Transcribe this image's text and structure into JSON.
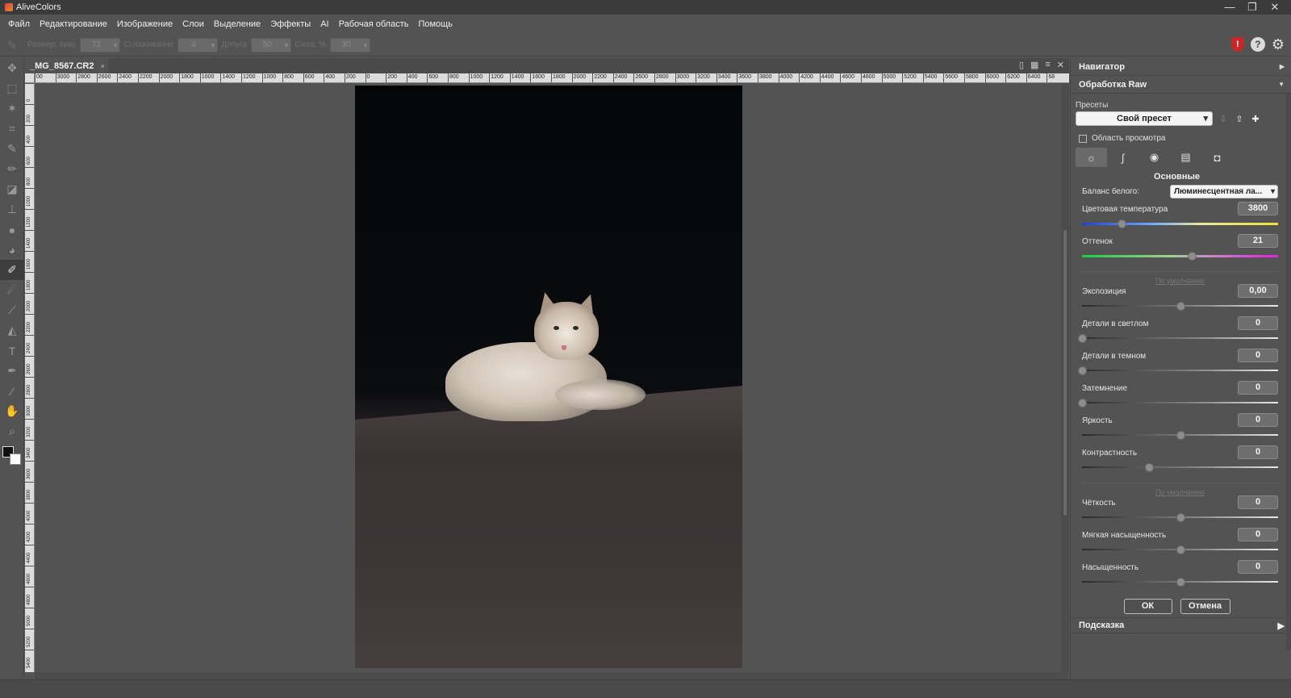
{
  "app": {
    "title": "AliveColors"
  },
  "window_controls": {
    "minimize": "—",
    "maximize": "❐",
    "close": "✕"
  },
  "menu": [
    "Файл",
    "Редактирование",
    "Изображение",
    "Слои",
    "Выделение",
    "Эффекты",
    "AI",
    "Рабочая область",
    "Помощь"
  ],
  "options_bar": {
    "size_label": "Размер, пикс",
    "size_value": "72",
    "smoothing_label": "Сглаживание",
    "smoothing_value": "4",
    "tolerance_label": "Допуск",
    "tolerance_value": "50",
    "strength_label": "Сила, %",
    "strength_value": "30"
  },
  "document": {
    "tab_title": "_MG_8567.CR2",
    "tab_close": "×"
  },
  "ruler": {
    "h_labels": [
      "00",
      "3000",
      "2800",
      "2600",
      "2400",
      "2200",
      "2000",
      "1800",
      "1600",
      "1400",
      "1200",
      "1000",
      "800",
      "600",
      "400",
      "200",
      "0",
      "200",
      "400",
      "600",
      "800",
      "1000",
      "1200",
      "1400",
      "1600",
      "1800",
      "2000",
      "2200",
      "2400",
      "2600",
      "2800",
      "3000",
      "3200",
      "3400",
      "3600",
      "3800",
      "4000",
      "4200",
      "4400",
      "4600",
      "4800",
      "5000",
      "5200",
      "5400",
      "5600",
      "5800",
      "6000",
      "6200",
      "6400",
      "68"
    ],
    "v_labels": [
      "0",
      "200",
      "400",
      "600",
      "800",
      "1000",
      "1200",
      "1400",
      "1600",
      "1800",
      "2000",
      "2200",
      "2400",
      "2600",
      "2800",
      "3000",
      "3200",
      "3400",
      "3600",
      "3800",
      "4000",
      "4200",
      "4400",
      "4600",
      "4800",
      "5000",
      "5200",
      "5400"
    ]
  },
  "panels": {
    "navigator": "Навигатор",
    "raw": "Обработка Raw",
    "hint": "Подсказка"
  },
  "raw": {
    "presets_label": "Пресеты",
    "preset_value": "Свой пресет",
    "preview_area_label": "Область просмотра",
    "section_title": "Основные",
    "wb_label": "Баланс белого:",
    "wb_value": "Люминесцентная ла...",
    "default_link": "По умолчанию",
    "ok": "ОК",
    "cancel": "Отмена",
    "sliders_group1": [
      {
        "label": "Цветовая температура",
        "value": "3800",
        "pos": 0.2,
        "style": "temp"
      },
      {
        "label": "Оттенок",
        "value": "21",
        "pos": 0.56,
        "style": "tint"
      }
    ],
    "sliders_group2": [
      {
        "label": "Экспозиция",
        "value": "0,00",
        "pos": 0.5
      },
      {
        "label": "Детали в светлом",
        "value": "0",
        "pos": 0.0
      },
      {
        "label": "Детали в темном",
        "value": "0",
        "pos": 0.0
      },
      {
        "label": "Затемнение",
        "value": "0",
        "pos": 0.0
      },
      {
        "label": "Яркость",
        "value": "0",
        "pos": 0.5
      },
      {
        "label": "Контрастность",
        "value": "0",
        "pos": 0.34
      }
    ],
    "sliders_group3": [
      {
        "label": "Чёткость",
        "value": "0",
        "pos": 0.5
      },
      {
        "label": "Мягкая насыщенность",
        "value": "0",
        "pos": 0.5
      },
      {
        "label": "Насыщенность",
        "value": "0",
        "pos": 0.5
      }
    ]
  },
  "toolbox": [
    "move-icon",
    "marquee-icon",
    "magic-wand-icon",
    "crop-icon",
    "brush-icon",
    "pencil-icon",
    "eraser-icon",
    "clone-stamp-icon",
    "blur-icon",
    "dodge-icon",
    "healing-brush-icon",
    "smudge-icon",
    "gradient-icon",
    "fill-icon",
    "text-icon",
    "pen-icon",
    "eyedropper-icon",
    "hand-icon",
    "zoom-icon"
  ]
}
